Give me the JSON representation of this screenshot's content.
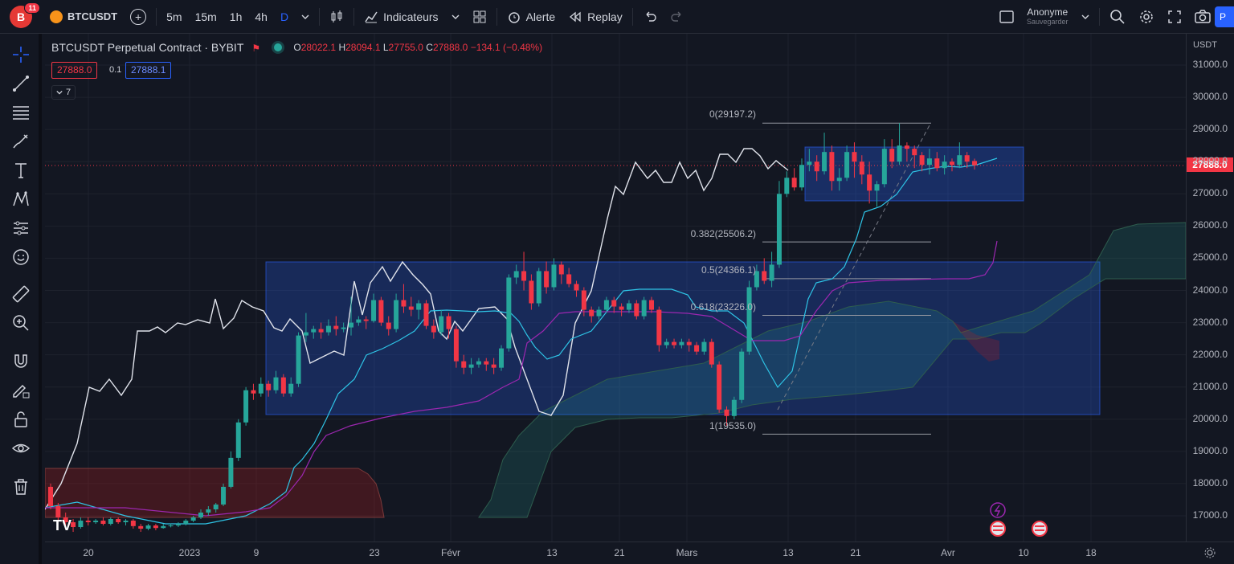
{
  "topbar": {
    "notif_count": "11",
    "symbol": "BTCUSDT",
    "timeframes": [
      "5m",
      "15m",
      "1h",
      "4h",
      "D"
    ],
    "active_timeframe": "D",
    "indicators_label": "Indicateurs",
    "alert_label": "Alerte",
    "replay_label": "Replay",
    "user_name": "Anonyme",
    "user_sub": "Sauvegarder",
    "publish_label": "P"
  },
  "legend": {
    "title": "BTCUSDT Perpetual Contract · BYBIT",
    "o_label": "O",
    "o": "28022.1",
    "h_label": "H",
    "h": "28094.1",
    "l_label": "L",
    "l": "27755.0",
    "c_label": "C",
    "c": "27888.0",
    "change": "−134.1 (−0.48%)",
    "sell_price": "27888.0",
    "spread": "0.1",
    "buy_price": "27888.1",
    "indicator_count": "7"
  },
  "colors": {
    "up": "#26a69a",
    "down": "#f23645",
    "tenkan": "#2ec4e6",
    "kijun": "#9c27b0",
    "chikou": "#e0e3eb",
    "rect": "#2962ff"
  },
  "chart_data": {
    "type": "candlestick",
    "currency": "USDT",
    "last_price": "27888.0",
    "y_ticks": [
      "31000.0",
      "30000.0",
      "29000.0",
      "28000.0",
      "27000.0",
      "26000.0",
      "25000.0",
      "24000.0",
      "23000.0",
      "22000.0",
      "21000.0",
      "20000.0",
      "19000.0",
      "18000.0",
      "17000.0"
    ],
    "x_ticks": [
      "20",
      "2023",
      "9",
      "23",
      "Févr",
      "13",
      "21",
      "Mars",
      "13",
      "21",
      "Avr",
      "10",
      "18"
    ],
    "fib_levels": [
      {
        "label": "0(29197.2)",
        "price": 29197.2
      },
      {
        "label": "0.382(25506.2)",
        "price": 25506.2
      },
      {
        "label": "0.5(24366.1)",
        "price": 24366.1
      },
      {
        "label": "0.618(23226.0)",
        "price": 23226.0
      },
      {
        "label": "1(19535.0)",
        "price": 19535.0
      }
    ],
    "zones": [
      {
        "name": "range-2023",
        "top": 24900,
        "bottom": 20200
      },
      {
        "name": "range-march",
        "top": 28500,
        "bottom": 26800
      }
    ]
  }
}
